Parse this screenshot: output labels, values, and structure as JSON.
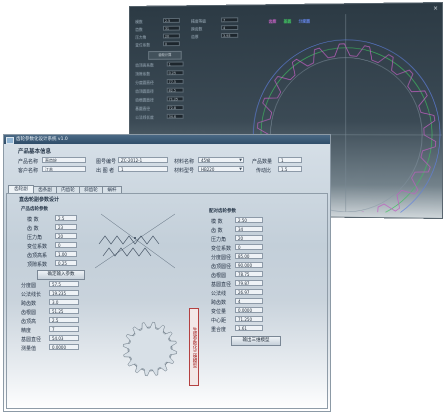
{
  "bg_window": {
    "close_label": "×",
    "fields": [
      {
        "label": "模数",
        "value": "2.5"
      },
      {
        "label": "齿数",
        "value": "31"
      },
      {
        "label": "压力角",
        "value": "20"
      },
      {
        "label": "变位系数",
        "value": "0"
      }
    ],
    "button_label": "齿轮计算",
    "params": [
      {
        "label": "齿顶高系数",
        "value": "1"
      },
      {
        "label": "顶隙系数",
        "value": "0.25"
      },
      {
        "label": "分度圆直径",
        "value": "77.5"
      },
      {
        "label": "齿顶圆直径",
        "value": "82.5"
      },
      {
        "label": "齿根圆直径",
        "value": "71.25"
      },
      {
        "label": "基圆直径",
        "value": "72.8"
      },
      {
        "label": "公法线长度",
        "value": "34.6"
      }
    ],
    "right_params": [
      {
        "label": "精度等级",
        "value": "7"
      },
      {
        "label": "跨齿数",
        "value": "4"
      },
      {
        "label": "齿厚",
        "value": "3.93"
      }
    ],
    "legend": [
      {
        "label": "齿廓",
        "color": "#c060c0"
      },
      {
        "label": "基圆",
        "color": "#40c060"
      },
      {
        "label": "分度圆",
        "color": "#6080e0"
      }
    ]
  },
  "window": {
    "title": "齿轮参数化设计系统 v1.0",
    "section_title": "产品基本信息",
    "info": {
      "product_name_label": "产品名称",
      "product_name": "直齿轮",
      "drawing_no_label": "图号编号",
      "drawing_no": "ZC-2012-1",
      "material_name_label": "材料名称",
      "material_name": "45钢",
      "product_qty_label": "产品数量",
      "product_qty": "1",
      "customer_label": "客户名称",
      "customer": "江苏",
      "drawer_label": "出 图 者",
      "drawer": "1",
      "material_grade_label": "材料型号",
      "material_grade": "HB220",
      "efficiency_label": "传动比",
      "efficiency": "1.5"
    },
    "tabs": [
      "齿轮副",
      "齿条副",
      "内齿轮",
      "斜齿轮",
      "蜗杆"
    ],
    "panel_title": "直齿轮副参数设计",
    "left_group_title": "产品齿轮参数",
    "left_params": [
      {
        "label": "模 数",
        "value": "2.5"
      },
      {
        "label": "齿 数",
        "value": "23"
      },
      {
        "label": "压力角",
        "value": "20"
      },
      {
        "label": "变位系数",
        "value": "0"
      },
      {
        "label": "齿顶高系",
        "value": "1.00"
      },
      {
        "label": "顶隙系数",
        "value": "0.25"
      }
    ],
    "calc_button": "确定输入参数",
    "lower_params": [
      {
        "label": "分度圆",
        "value": "57.5"
      },
      {
        "label": "公法线长",
        "value": "19.235"
      },
      {
        "label": "跨齿数",
        "value": "3.0"
      },
      {
        "label": "齿根圆",
        "value": "51.25"
      },
      {
        "label": "齿顶高",
        "value": "2.5"
      },
      {
        "label": "精度",
        "value": "7"
      },
      {
        "label": "基圆直径",
        "value": "54.03"
      },
      {
        "label": "测量值",
        "value": "0.0000"
      }
    ],
    "red_button": "生成参数化三维模型",
    "right_group_title": "配对齿轮参数",
    "right_params": [
      {
        "label": "模 数",
        "value": "2.50"
      },
      {
        "label": "齿 数",
        "value": "34"
      },
      {
        "label": "压力角",
        "value": "20"
      },
      {
        "label": "变位系数",
        "value": "0"
      },
      {
        "label": "分度圆径",
        "value": "85.00"
      },
      {
        "label": "齿顶圆径",
        "value": "90.000"
      },
      {
        "label": "齿根圆",
        "value": "78.75"
      },
      {
        "label": "基圆直径",
        "value": "79.87"
      },
      {
        "label": "公法线",
        "value": "26.97"
      },
      {
        "label": "跨齿数",
        "value": "4"
      },
      {
        "label": "变位量",
        "value": "0.0000"
      },
      {
        "label": "中心距",
        "value": "71.250"
      },
      {
        "label": "重合度",
        "value": "1.61"
      }
    ],
    "generate_button": "输出三维模型"
  }
}
